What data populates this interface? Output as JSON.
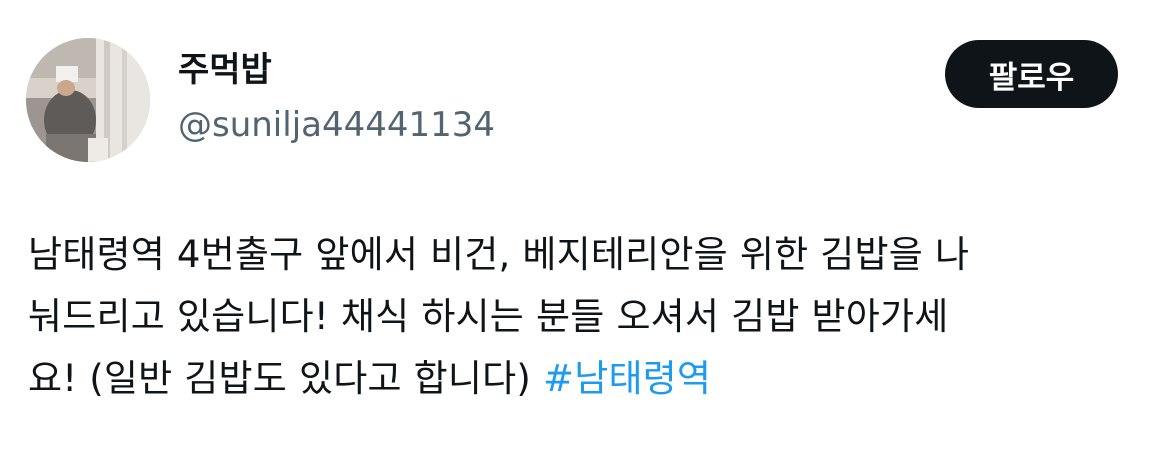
{
  "user": {
    "display_name": "주먹밥",
    "handle": "@sunilja44441134",
    "avatar_icon": "profile-photo"
  },
  "follow_button": {
    "label": "팔로우"
  },
  "tweet": {
    "line1": "남태령역 4번출구 앞에서 비건, 베지테리안을 위한 김밥을 나",
    "line2": "눠드리고 있습니다! 채식 하시는 분들 오셔서 김밥 받아가세",
    "line3": "요! (일반 김밥도 있다고 합니다) ",
    "hashtag": "#남태령역"
  },
  "colors": {
    "text": "#0f1419",
    "secondary": "#536471",
    "link": "#1d9bf0",
    "button_bg": "#0f1419"
  }
}
